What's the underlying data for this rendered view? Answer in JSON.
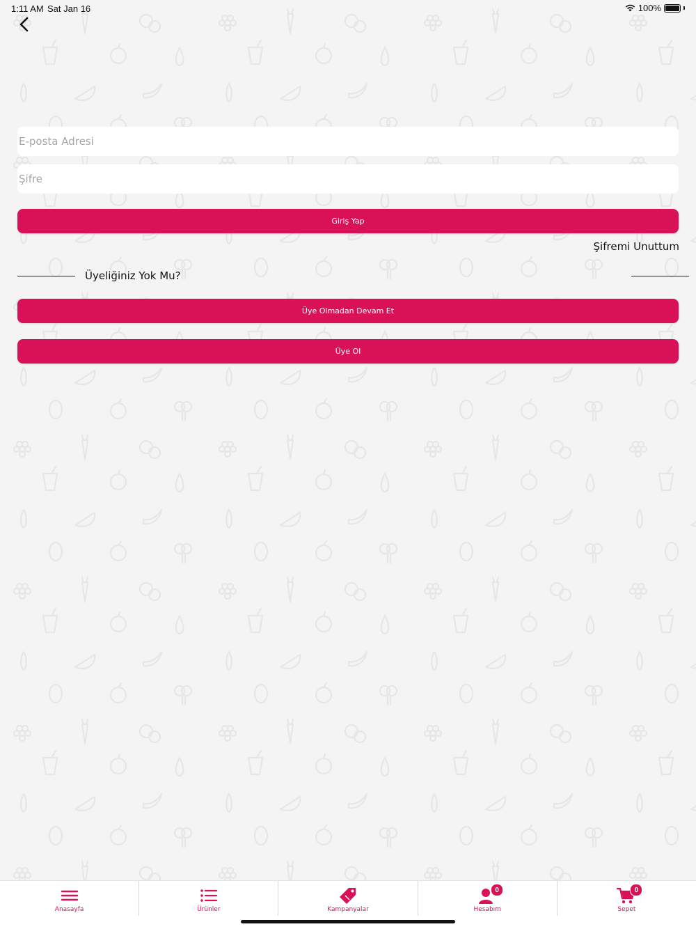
{
  "status_bar": {
    "time": "1:11 AM",
    "date": "Sat Jan 16",
    "battery": "100%"
  },
  "login_form": {
    "email_placeholder": "E-posta Adresi",
    "email_value": "",
    "password_placeholder": "Şifre",
    "password_value": "",
    "login_label": "Giriş Yap",
    "forgot_label": "Şifremi Unuttum"
  },
  "signup_section": {
    "prompt": "Üyeliğiniz Yok Mu?",
    "guest_label": "Üye Olmadan Devam Et",
    "register_label": "Üye Ol"
  },
  "tab_bar": {
    "items": [
      {
        "label": "Anasayfa",
        "icon": "menu-icon"
      },
      {
        "label": "Ürünler",
        "icon": "list-icon"
      },
      {
        "label": "Kampanyalar",
        "icon": "tag-icon"
      },
      {
        "label": "Hesabım",
        "icon": "user-icon",
        "badge": "0"
      },
      {
        "label": "Sepet",
        "icon": "cart-icon",
        "badge": "0"
      }
    ]
  },
  "colors": {
    "accent": "#d81159",
    "background": "#f4f4f4"
  }
}
